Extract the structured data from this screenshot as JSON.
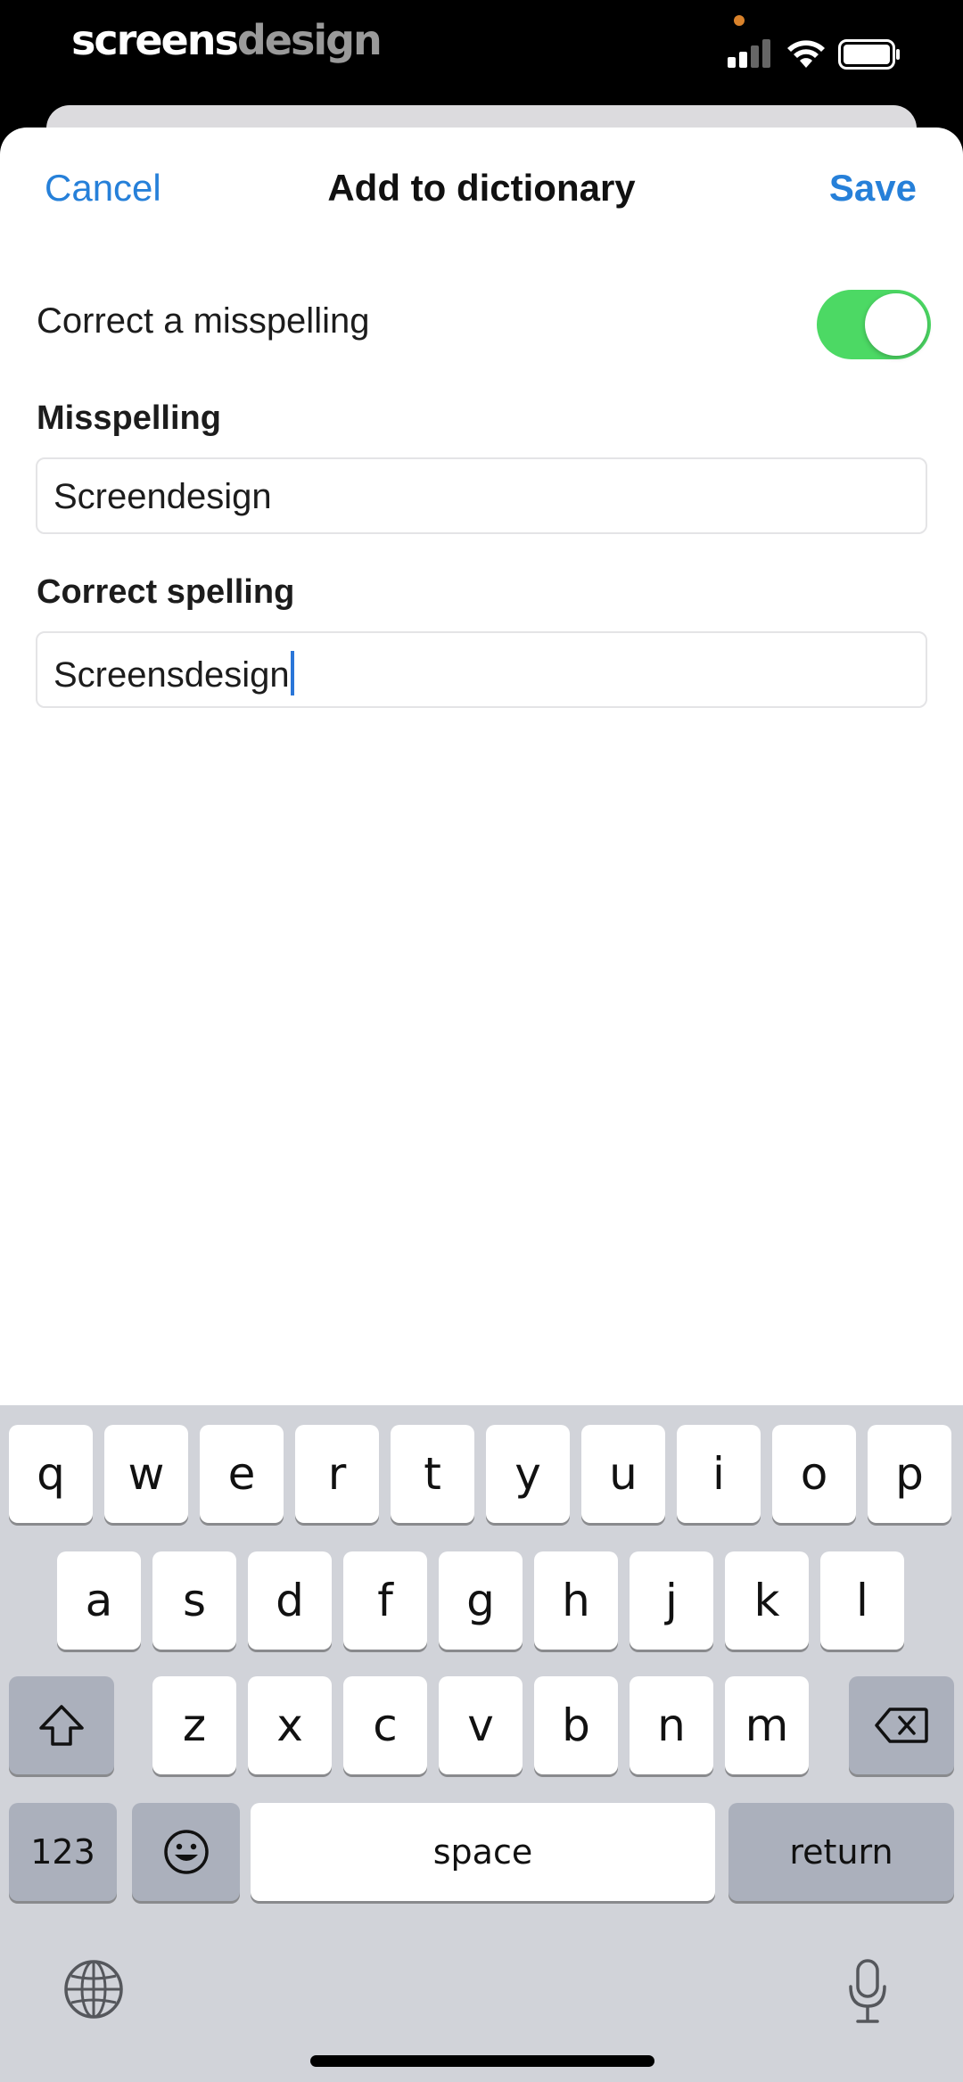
{
  "status_bar": {
    "brand_part1": "screens",
    "brand_part2": "design"
  },
  "nav": {
    "cancel": "Cancel",
    "title": "Add to dictionary",
    "save": "Save"
  },
  "toggle": {
    "label": "Correct a misspelling",
    "on": true,
    "color": "#4cd964"
  },
  "fields": {
    "misspelling": {
      "label": "Misspelling",
      "value": "Screendesign"
    },
    "correct": {
      "label": "Correct spelling",
      "value": "Screensdesign"
    }
  },
  "keyboard": {
    "row1": [
      "q",
      "w",
      "e",
      "r",
      "t",
      "y",
      "u",
      "i",
      "o",
      "p"
    ],
    "row2": [
      "a",
      "s",
      "d",
      "f",
      "g",
      "h",
      "j",
      "k",
      "l"
    ],
    "row3": [
      "z",
      "x",
      "c",
      "v",
      "b",
      "n",
      "m"
    ],
    "numbers_key": "123",
    "space_key": "space",
    "return_key": "return"
  },
  "colors": {
    "accent": "#2680d9",
    "toggle_on": "#4cd964",
    "caret": "#2a76d8"
  }
}
